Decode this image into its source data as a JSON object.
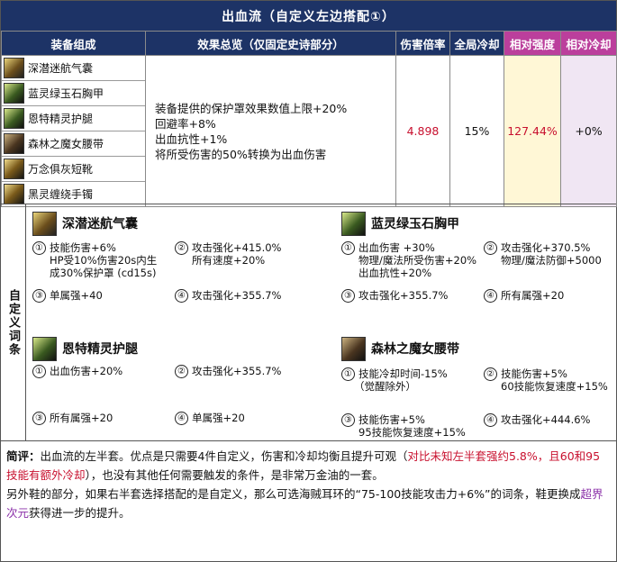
{
  "title": "出血流（自定义左边搭配①）",
  "headers": {
    "equip": "装备组成",
    "effect": "效果总览（仅固定史诗部分）",
    "damage": "伤害倍率",
    "cooldown": "全局冷却",
    "rel_strength": "相对强度",
    "rel_cooldown": "相对冷却"
  },
  "equipment": [
    {
      "name": "深潜迷航气囊",
      "icon": "airbag-icon"
    },
    {
      "name": "蓝灵绿玉石胸甲",
      "icon": "chestplate-icon"
    },
    {
      "name": "恩特精灵护腿",
      "icon": "leggings-icon"
    },
    {
      "name": "森林之魔女腰带",
      "icon": "belt-icon"
    },
    {
      "name": "万念俱灰短靴",
      "icon": "boots-icon"
    },
    {
      "name": "黑灵缠绕手镯",
      "icon": "bracelet-icon"
    }
  ],
  "effects": [
    "装备提供的保护罩效果数值上限+20%",
    "回避率+8%",
    "出血抗性+1%",
    "将所受伤害的50%转换为出血伤害"
  ],
  "stats": {
    "damage": "4.898",
    "cooldown": "15%",
    "rel_strength": "127.44%",
    "rel_cooldown": "+0%"
  },
  "custom_label": "自定义词条",
  "custom": {
    "airbag": {
      "name": "深潜迷航气囊",
      "l1": "技能伤害+6%",
      "l1b": "HP受10%伤害20s内生",
      "l1c": "成30%保护罩 (cd15s)",
      "l2": "攻击强化+415.0%",
      "l2b": "所有速度+20%",
      "l3": "单属强+40",
      "l4": "攻击强化+355.7%"
    },
    "chest": {
      "name": "蓝灵绿玉石胸甲",
      "l1": "出血伤害 +30%",
      "l1b": "物理/魔法所受伤害+20%",
      "l1c": "出血抗性+20%",
      "l2": "攻击强化+370.5%",
      "l2b": "物理/魔法防御+5000",
      "l3": "攻击强化+355.7%",
      "l4": "所有属强+20"
    },
    "legs": {
      "name": "恩特精灵护腿",
      "l1": "出血伤害+20%",
      "l2": "攻击强化+355.7%",
      "l3": "所有属强+20",
      "l4": "单属强+20"
    },
    "belt": {
      "name": "森林之魔女腰带",
      "l1": "技能冷却时间-15%",
      "l1b": "（觉醒除外）",
      "l2": "技能伤害+5%",
      "l2b": "60技能恢复速度+15%",
      "l3": "技能伤害+5%",
      "l3b": "95技能恢复速度+15%",
      "l4": "攻击强化+444.6%"
    }
  },
  "nums": [
    "①",
    "②",
    "③",
    "④"
  ],
  "comment": {
    "label": "简评：",
    "t1": "出血流的左半套。优点是只需要4件自定义，伤害和冷却均衡且提升可观（",
    "t1red": "对比未知左半套强约5.8%，且60和95技能有额外冷却",
    "t2": "），也没有其他任何需要触发的条件，是非常万金油的一套。",
    "t3": "另外鞋的部分，如果右半套选择搭配的是自定义，那么可选海贼耳环的“75-100技能攻击力+6%”的词条，鞋更换成",
    "t3purple": "超界次元",
    "t4": "获得进一步的提升。"
  },
  "colors": {
    "header": "#1d3366",
    "pink_header": "#bb3f9c",
    "red": "#c8102e",
    "purple": "#8a2fa8"
  }
}
